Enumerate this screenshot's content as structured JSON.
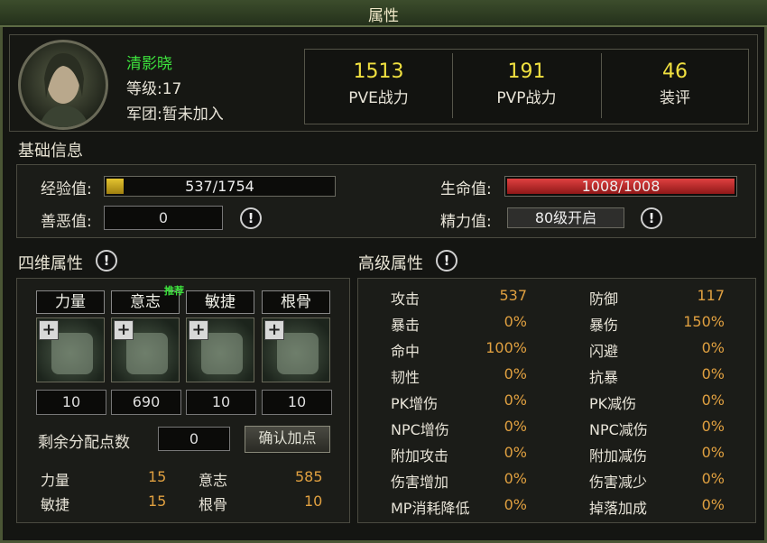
{
  "window": {
    "title": "属性"
  },
  "profile": {
    "name": "清影晓",
    "level_label": "等级:17",
    "legion_label": "军团:暂未加入"
  },
  "stats": [
    {
      "value": "1513",
      "label": "PVE战力"
    },
    {
      "value": "191",
      "label": "PVP战力"
    },
    {
      "value": "46",
      "label": "装评"
    }
  ],
  "basic": {
    "title": "基础信息",
    "exp_label": "经验值:",
    "exp_value": "537/1754",
    "exp_fraction": 0.306,
    "karma_label": "善恶值:",
    "karma_value": "0",
    "hp_label": "生命值:",
    "hp_value": "1008/1008",
    "hp_fraction": 1.0,
    "energy_label": "精力值:",
    "energy_value": "80级开启"
  },
  "four_dim": {
    "title": "四维属性",
    "attrs": [
      {
        "name": "力量",
        "value": "10",
        "recommended": ""
      },
      {
        "name": "意志",
        "value": "690",
        "recommended": "推荐"
      },
      {
        "name": "敏捷",
        "value": "10",
        "recommended": ""
      },
      {
        "name": "根骨",
        "value": "10",
        "recommended": ""
      }
    ],
    "remaining_label": "剩余分配点数",
    "remaining_value": "0",
    "confirm_label": "确认加点",
    "summary": [
      {
        "label": "力量",
        "value": "15"
      },
      {
        "label": "意志",
        "value": "585"
      },
      {
        "label": "敏捷",
        "value": "15"
      },
      {
        "label": "根骨",
        "value": "10"
      }
    ]
  },
  "advanced": {
    "title": "高级属性",
    "left": [
      {
        "label": "攻击",
        "value": "537"
      },
      {
        "label": "暴击",
        "value": "0%"
      },
      {
        "label": "命中",
        "value": "100%"
      },
      {
        "label": "韧性",
        "value": "0%"
      },
      {
        "label": "PK增伤",
        "value": "0%"
      },
      {
        "label": "NPC增伤",
        "value": "0%"
      },
      {
        "label": "附加攻击",
        "value": "0%"
      },
      {
        "label": "伤害增加",
        "value": "0%"
      },
      {
        "label": "MP消耗降低",
        "value": "0%"
      }
    ],
    "right": [
      {
        "label": "防御",
        "value": "117"
      },
      {
        "label": "暴伤",
        "value": "150%"
      },
      {
        "label": "闪避",
        "value": "0%"
      },
      {
        "label": "抗暴",
        "value": "0%"
      },
      {
        "label": "PK减伤",
        "value": "0%"
      },
      {
        "label": "NPC减伤",
        "value": "0%"
      },
      {
        "label": "附加减伤",
        "value": "0%"
      },
      {
        "label": "伤害减少",
        "value": "0%"
      },
      {
        "label": "掉落加成",
        "value": "0%"
      }
    ]
  },
  "colors": {
    "accent": "#f0e040",
    "hp": "#c0282a",
    "exp": "#d4b020",
    "name": "#3de23d",
    "value": "#e0a040"
  }
}
